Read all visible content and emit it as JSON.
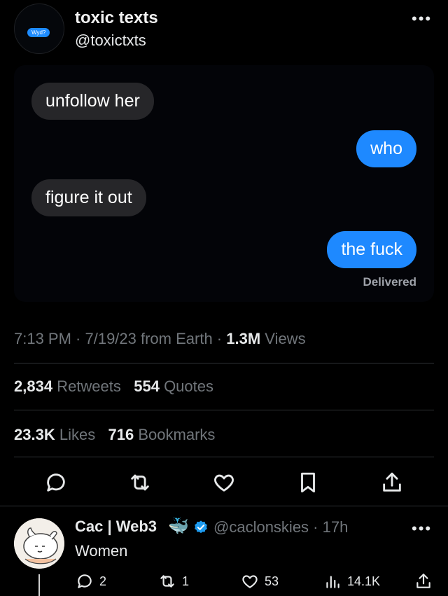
{
  "tweet": {
    "author_name": "toxic texts",
    "author_handle": "@toxictxts",
    "avatar_text": "Wyd?",
    "more_label": "•••",
    "messages": [
      {
        "text": "unfollow her",
        "side": "received"
      },
      {
        "text": "who",
        "side": "sent"
      },
      {
        "text": "figure it out",
        "side": "received"
      },
      {
        "text": "the fuck",
        "side": "sent"
      }
    ],
    "delivered_label": "Delivered",
    "meta": {
      "time_date_source": "7:13 PM · 7/19/23 from Earth · ",
      "views_count": "1.3M",
      "views_label": " Views"
    },
    "stats": {
      "retweets_count": "2,834",
      "retweets_label": " Retweets",
      "quotes_count": "554",
      "quotes_label": " Quotes",
      "likes_count": "23.3K",
      "likes_label": " Likes",
      "bookmarks_count": "716",
      "bookmarks_label": " Bookmarks"
    },
    "actions": [
      "reply-icon",
      "retweet-icon",
      "like-icon",
      "bookmark-icon",
      "share-icon"
    ]
  },
  "reply": {
    "author_name": "Cac | Web3",
    "emoji": "🐳",
    "handle_time": "@caclonskies · 17h",
    "more_label": "•••",
    "text": "Women",
    "reply_count": "2",
    "retweet_count": "1",
    "like_count": "53",
    "views_count": "14.1K"
  },
  "colors": {
    "background": "#000000",
    "sent_bubble": "#1e89ff",
    "received_bubble": "#262629",
    "verified": "#1d9bf0",
    "muted_text": "#71767b"
  }
}
